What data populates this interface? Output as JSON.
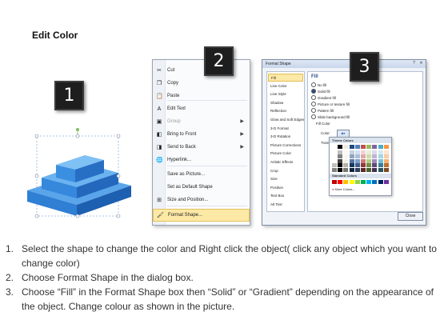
{
  "title": "Edit Color",
  "badges": [
    "1",
    "2",
    "3"
  ],
  "context_menu": {
    "items": [
      {
        "label": "Cut",
        "icon": "scissors-icon",
        "glyph": "✂",
        "disabled": false,
        "submenu": false
      },
      {
        "label": "Copy",
        "icon": "copy-icon",
        "glyph": "❐",
        "disabled": false,
        "submenu": false
      },
      {
        "label": "Paste",
        "icon": "paste-icon",
        "glyph": "📋",
        "disabled": false,
        "submenu": false
      },
      {
        "label": "Edit Text",
        "icon": "edit-text-icon",
        "glyph": "A",
        "disabled": false,
        "submenu": false
      },
      {
        "label": "Group",
        "icon": "group-icon",
        "glyph": "▣",
        "disabled": true,
        "submenu": true
      },
      {
        "label": "Bring to Front",
        "icon": "bring-front-icon",
        "glyph": "◧",
        "disabled": false,
        "submenu": true
      },
      {
        "label": "Send to Back",
        "icon": "send-back-icon",
        "glyph": "◨",
        "disabled": false,
        "submenu": true
      },
      {
        "label": "Hyperlink...",
        "icon": "hyperlink-icon",
        "glyph": "🌐",
        "disabled": false,
        "submenu": false
      },
      {
        "label": "Save as Picture...",
        "icon": "",
        "glyph": "",
        "disabled": false,
        "submenu": false
      },
      {
        "label": "Set as Default Shape",
        "icon": "",
        "glyph": "",
        "disabled": false,
        "submenu": false
      },
      {
        "label": "Size and Position...",
        "icon": "size-position-icon",
        "glyph": "⊞",
        "disabled": false,
        "submenu": false
      },
      {
        "label": "Format Shape...",
        "icon": "format-shape-icon",
        "glyph": "🖌",
        "disabled": false,
        "submenu": false
      }
    ]
  },
  "format_dialog": {
    "title": "Format Shape",
    "nav": [
      "Fill",
      "Line Color",
      "Line Style",
      "Shadow",
      "Reflection",
      "Glow and Soft Edges",
      "3-D Format",
      "3-D Rotation",
      "Picture Corrections",
      "Picture Color",
      "Artistic Effects",
      "Crop",
      "Size",
      "Position",
      "Text Box",
      "Alt Text"
    ],
    "section_title": "Fill",
    "options": [
      {
        "label": "No fill",
        "selected": false
      },
      {
        "label": "Solid fill",
        "selected": true
      },
      {
        "label": "Gradient fill",
        "selected": false
      },
      {
        "label": "Picture or texture fill",
        "selected": false
      },
      {
        "label": "Pattern fill",
        "selected": false
      },
      {
        "label": "Slide background fill",
        "selected": false
      }
    ],
    "fill_color_label": "Fill Color",
    "color_label": "Color:",
    "transparency_label": "Transpa",
    "theme_colors_label": "Theme Colors",
    "standard_colors_label": "Standard Colors",
    "more_colors_label": "More Colors...",
    "close_label": "Close",
    "theme_colors": [
      "#ffffff",
      "#000000",
      "#eeece1",
      "#1f497d",
      "#4f81bd",
      "#c0504d",
      "#9bbb59",
      "#8064a2",
      "#4bacc6",
      "#f79646"
    ],
    "standard_colors": [
      "#c00000",
      "#ff0000",
      "#ffc000",
      "#ffff00",
      "#92d050",
      "#00b050",
      "#00b0f0",
      "#0070c0",
      "#002060",
      "#7030a0"
    ]
  },
  "instructions": [
    {
      "number": "1.",
      "text": "Select the shape to change the color and Right click the object( click any object which you want to change color)"
    },
    {
      "number": "2.",
      "text": "Choose Format Shape in the dialog box."
    },
    {
      "number": "3.",
      "text": "Choose “Fill” in the Format Shape box then “Solid” or “Gradient” depending on the appearance of the object. Change colour as shown in the picture."
    }
  ]
}
